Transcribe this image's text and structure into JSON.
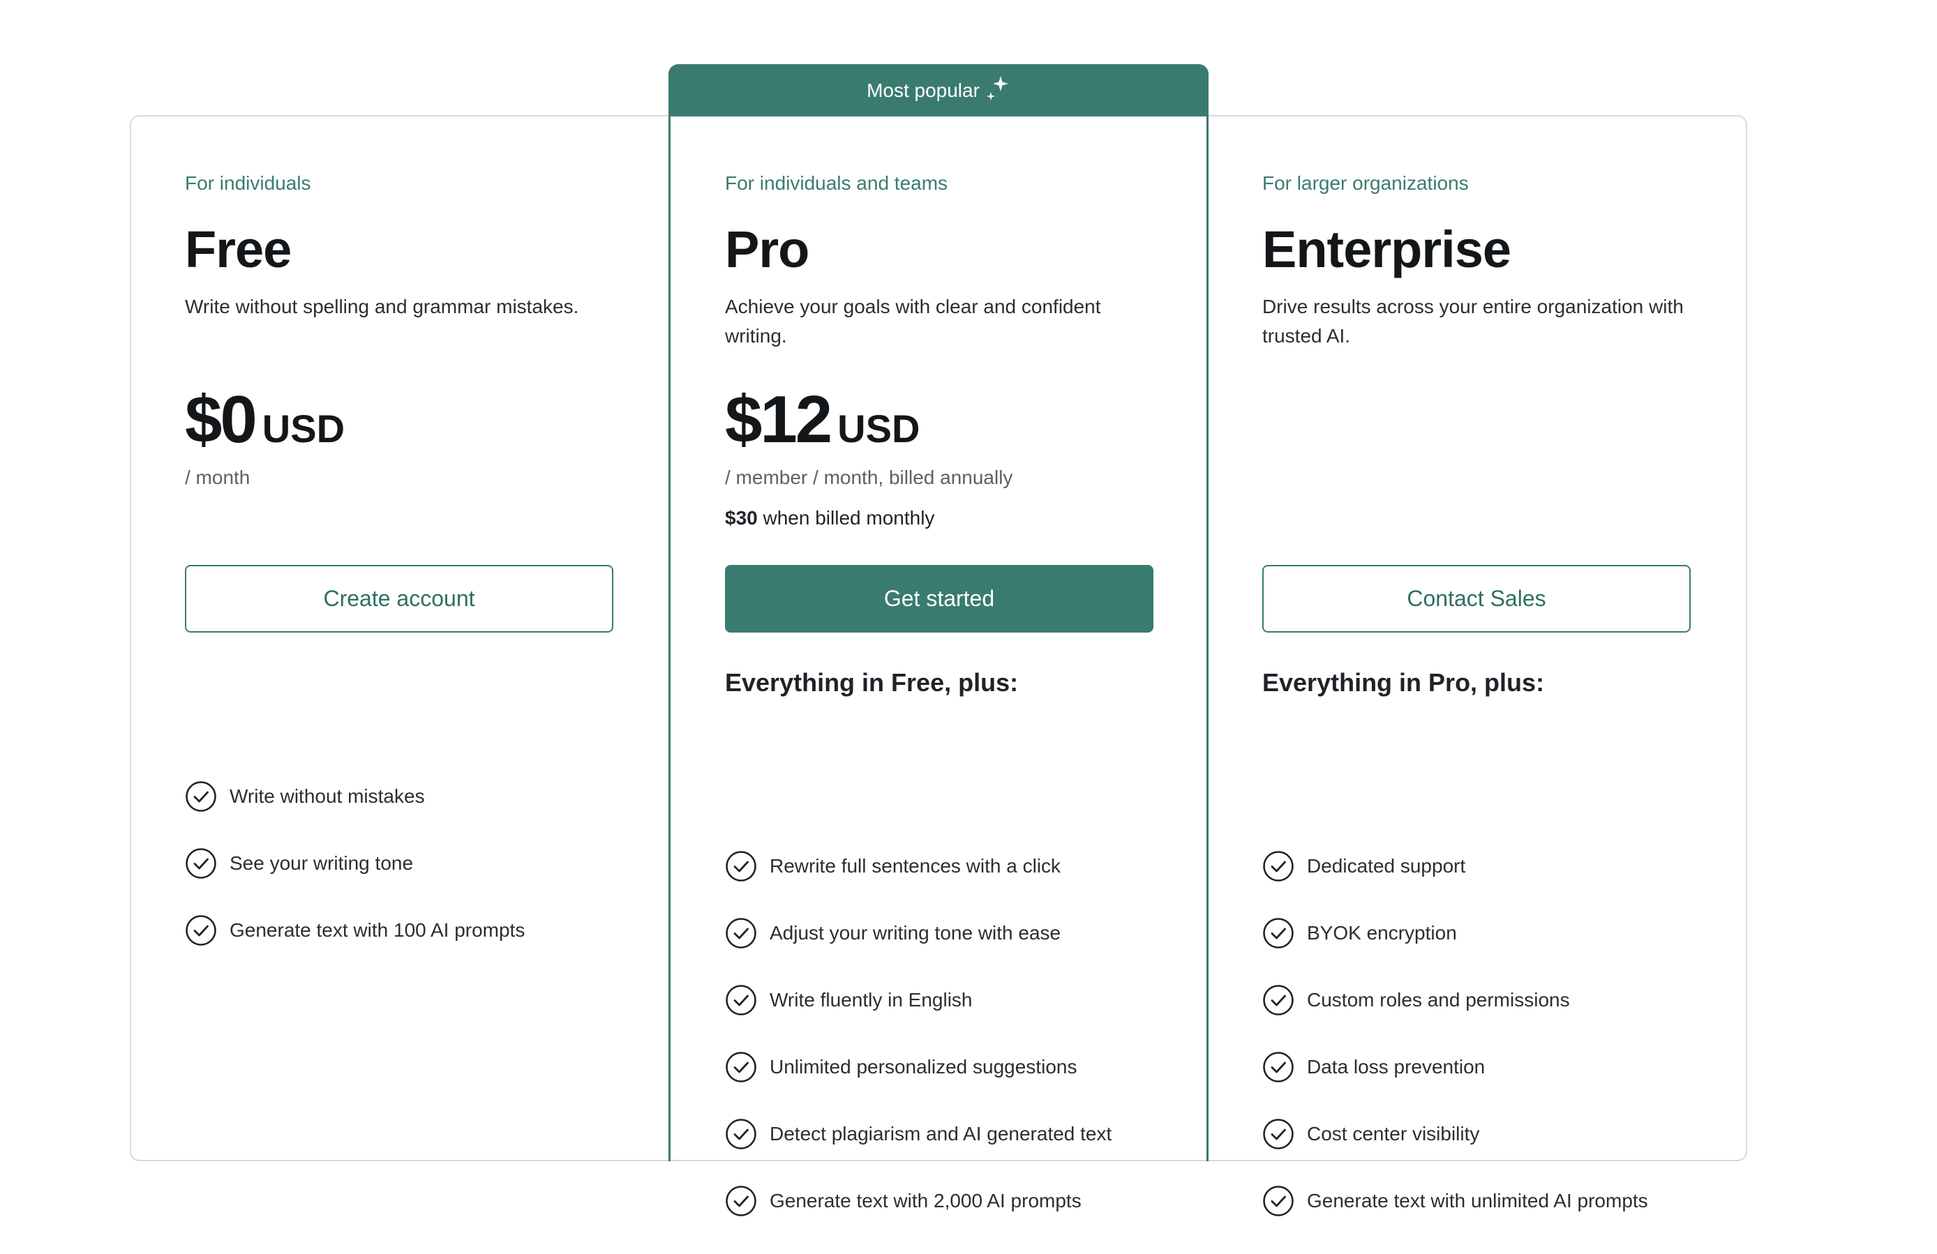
{
  "colors": {
    "accent": "#3a7b6f",
    "text": "#1f2328",
    "muted": "#5b6168",
    "border": "#d7d9dc"
  },
  "badge": {
    "label": "Most popular",
    "icon": "sparkle-icon"
  },
  "plans": [
    {
      "audience": "For individuals",
      "name": "Free",
      "description": "Write without spelling and grammar mistakes.",
      "price_amount": "$0",
      "price_currency": "USD",
      "period": "/ month",
      "cta_label": "Create account",
      "features": [
        "Write without mistakes",
        "See your writing tone",
        "Generate text with 100 AI prompts"
      ]
    },
    {
      "audience": "For individuals and teams",
      "name": "Pro",
      "description": "Achieve your goals with clear and confident writing.",
      "price_amount": "$12",
      "price_currency": "USD",
      "period": "/ member / month, billed annually",
      "monthly_amount": "$30",
      "monthly_text": " when billed monthly",
      "cta_label": "Get started",
      "features_heading": "Everything in Free, plus:",
      "features": [
        "Rewrite full sentences with a click",
        "Adjust your writing tone with ease",
        "Write fluently in English",
        "Unlimited personalized suggestions",
        "Detect plagiarism and AI generated text",
        "Generate text with 2,000 AI prompts"
      ]
    },
    {
      "audience": "For larger organizations",
      "name": "Enterprise",
      "description": "Drive results across your entire organization with trusted AI.",
      "cta_label": "Contact Sales",
      "features_heading": "Everything in Pro, plus:",
      "features": [
        "Dedicated support",
        "BYOK encryption",
        "Custom roles and permissions",
        "Data loss prevention",
        "Cost center visibility",
        "Generate text with unlimited AI prompts"
      ]
    }
  ]
}
